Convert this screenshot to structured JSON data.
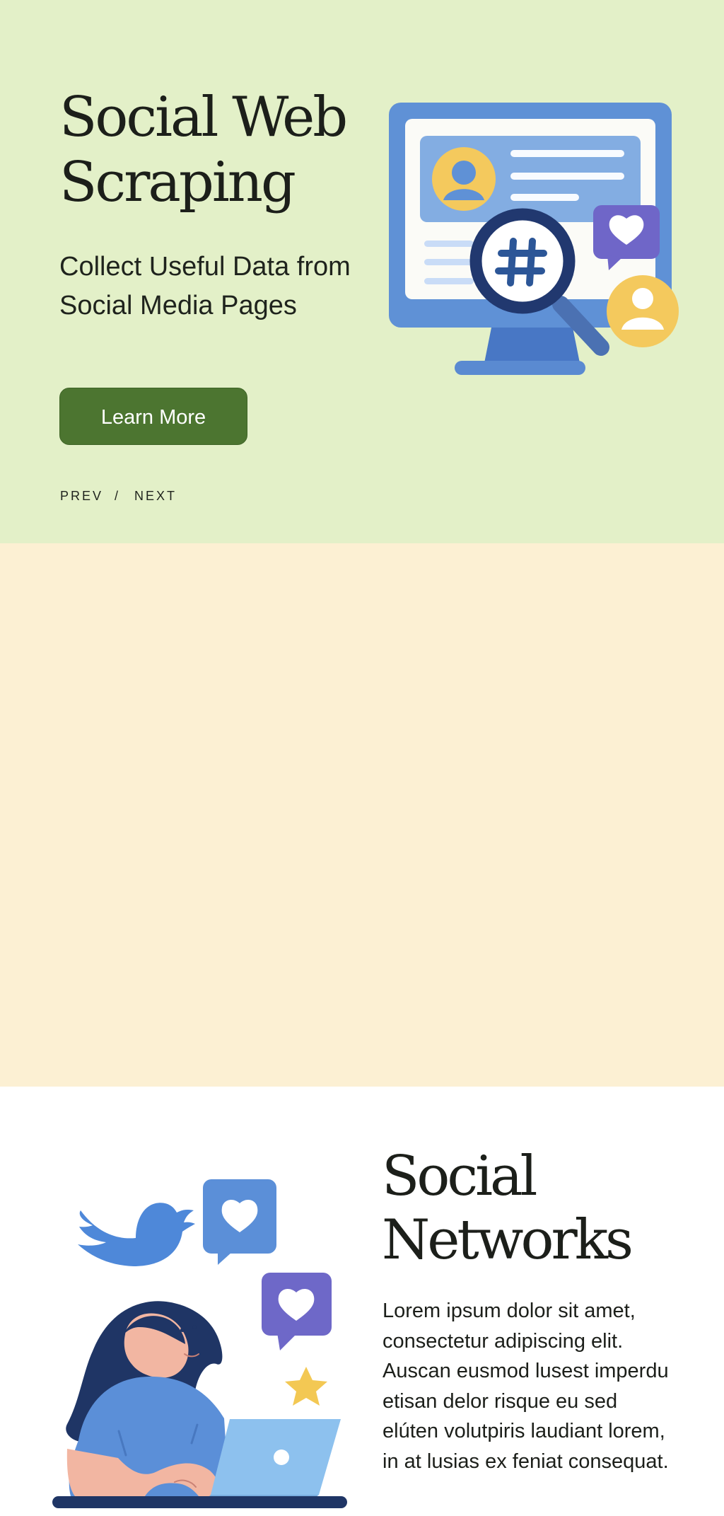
{
  "hero": {
    "title": "Social Web Scraping",
    "subtitle": "Collect Useful Data from Social Media Pages",
    "cta_label": "Learn More",
    "pager": {
      "prev_label": "PREV",
      "separator": "/",
      "next_label": "NEXT"
    },
    "illustration": {
      "icons": [
        "desktop-monitor-icon",
        "profile-avatar-icon",
        "magnifier-icon",
        "hashtag-icon",
        "heart-chat-bubble-icon",
        "user-avatar-icon"
      ]
    },
    "colors": {
      "background": "#e3f0c8",
      "button": "#4c7530",
      "monitor_blue": "#5f91d6",
      "avatar_yellow": "#f4c95d",
      "bubble_purple": "#6f66c8"
    }
  },
  "networks": {
    "title": "Social Networks",
    "body": "Lorem ipsum dolor sit amet, consectetur adipiscing elit. Auscan eusmod lusest imperdu etisan delor risque eu sed elúten volutpiris laudiant lorem, in at lusias ex feniat consequat.",
    "illustration": {
      "icons": [
        "bird-icon",
        "heart-chat-bubble-icon",
        "heart-chat-bubble-icon",
        "star-icon",
        "laptop-icon",
        "woman-user-icon"
      ]
    },
    "colors": {
      "background": "#fcf0d3",
      "bird_blue": "#4e88d9",
      "bubble_blue": "#5b8fd8",
      "bubble_purple": "#6e68c8",
      "star_yellow": "#f3c853",
      "navy": "#1f3565"
    }
  }
}
